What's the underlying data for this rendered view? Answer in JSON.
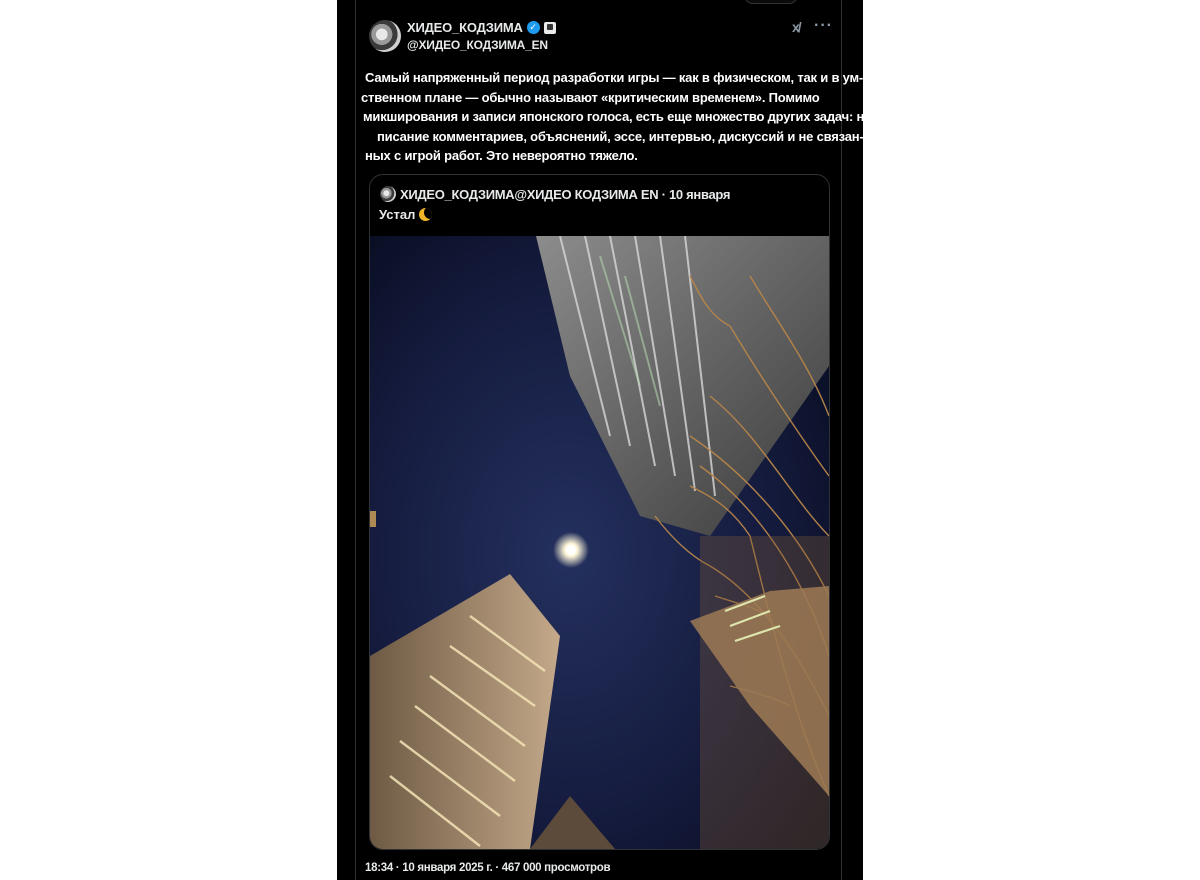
{
  "post": {
    "author_name": "ХИДЕО_КОДЗИМА",
    "author_handle": "@ХИДЕО_КОДЗИМА_EN",
    "text_lines": [
      "Самый напряженный период разработки игры — как в физическом, так и в ум-",
      "ственном плане — обычно называют «критическим временем». Помимо",
      "микширования и записи японского голоса, есть еще множество других задач: на-",
      "писание комментариев, объяснений, эссе, интервью, дискуссий и не связан-",
      "ных с игрой работ. Это невероятно тяжело."
    ],
    "meta": "18:34 · 10 января 2025 г. · 467 000 просмотров"
  },
  "quote": {
    "header": "ХИДЕО_КОДЗИМА@ХИДЕО КОДЗИМА EN · 10 января",
    "text": "Устал"
  },
  "icons": {
    "verified": "verified-badge-icon",
    "affiliate": "affiliate-badge-icon",
    "grok": "grok-icon",
    "more": "more-icon",
    "moon": "moon-emoji-icon"
  },
  "colors": {
    "background": "#000000",
    "verified_blue": "#1d9bf0",
    "text": "#e7e9ea",
    "border": "#2f3336"
  }
}
